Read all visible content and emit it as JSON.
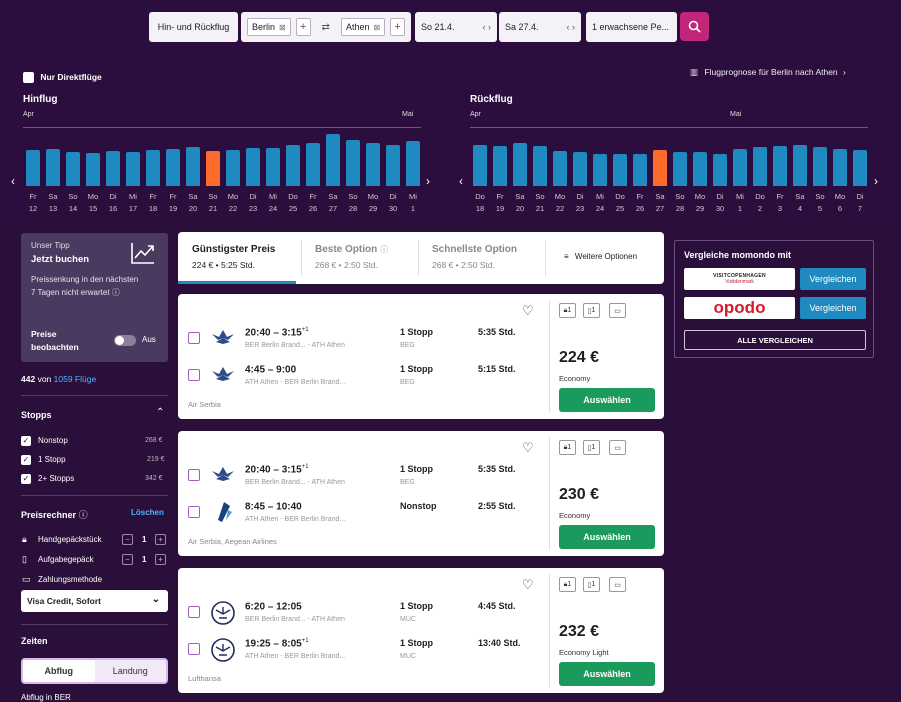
{
  "search": {
    "trip_type": "Hin- und Rückflug",
    "origin": "Berlin",
    "destination": "Athen",
    "swap_icon": "swap-icon",
    "depart_date": "So 21.4.",
    "return_date": "Sa 27.4.",
    "passengers": "1 erwachsene Pe...",
    "search_icon": "search-icon"
  },
  "options": {
    "direct_only": "Nur Direktflüge",
    "forecast_link": "Flugprognose für Berlin nach Athen"
  },
  "outbound": {
    "title": "Hinflug",
    "month_left": "Apr",
    "month_right": "Mai",
    "days": [
      {
        "wd": "Fr",
        "d": "12",
        "v": 0.64,
        "sel": false
      },
      {
        "wd": "Sa",
        "d": "13",
        "v": 0.66,
        "sel": false
      },
      {
        "wd": "So",
        "d": "14",
        "v": 0.61,
        "sel": false
      },
      {
        "wd": "Mo",
        "d": "15",
        "v": 0.59,
        "sel": false
      },
      {
        "wd": "Di",
        "d": "16",
        "v": 0.62,
        "sel": false
      },
      {
        "wd": "Mi",
        "d": "17",
        "v": 0.6,
        "sel": false
      },
      {
        "wd": "Fr",
        "d": "18",
        "v": 0.64,
        "sel": false
      },
      {
        "wd": "Fr",
        "d": "19",
        "v": 0.66,
        "sel": false
      },
      {
        "wd": "Sa",
        "d": "20",
        "v": 0.69,
        "sel": false
      },
      {
        "wd": "So",
        "d": "21",
        "v": 0.62,
        "sel": true
      },
      {
        "wd": "Mo",
        "d": "22",
        "v": 0.64,
        "sel": false
      },
      {
        "wd": "Di",
        "d": "23",
        "v": 0.67,
        "sel": false
      },
      {
        "wd": "Mi",
        "d": "24",
        "v": 0.67,
        "sel": false
      },
      {
        "wd": "Do",
        "d": "25",
        "v": 0.74,
        "sel": false
      },
      {
        "wd": "Fr",
        "d": "26",
        "v": 0.77,
        "sel": false
      },
      {
        "wd": "Sa",
        "d": "27",
        "v": 0.92,
        "sel": false
      },
      {
        "wd": "So",
        "d": "28",
        "v": 0.82,
        "sel": false
      },
      {
        "wd": "Mo",
        "d": "29",
        "v": 0.77,
        "sel": false
      },
      {
        "wd": "Di",
        "d": "30",
        "v": 0.74,
        "sel": false
      },
      {
        "wd": "Mi",
        "d": "1",
        "v": 0.81,
        "sel": false
      }
    ]
  },
  "return": {
    "title": "Rückflug",
    "month_left": "Apr",
    "month_right": "Mai",
    "days": [
      {
        "wd": "Do",
        "d": "18",
        "v": 0.73,
        "sel": false
      },
      {
        "wd": "Fr",
        "d": "19",
        "v": 0.71,
        "sel": false
      },
      {
        "wd": "Sa",
        "d": "20",
        "v": 0.77,
        "sel": false
      },
      {
        "wd": "So",
        "d": "21",
        "v": 0.71,
        "sel": false
      },
      {
        "wd": "Mo",
        "d": "22",
        "v": 0.62,
        "sel": false
      },
      {
        "wd": "Di",
        "d": "23",
        "v": 0.6,
        "sel": false
      },
      {
        "wd": "Mi",
        "d": "24",
        "v": 0.57,
        "sel": false
      },
      {
        "wd": "Do",
        "d": "25",
        "v": 0.57,
        "sel": false
      },
      {
        "wd": "Fr",
        "d": "26",
        "v": 0.57,
        "sel": false
      },
      {
        "wd": "Sa",
        "d": "27",
        "v": 0.64,
        "sel": true
      },
      {
        "wd": "So",
        "d": "28",
        "v": 0.6,
        "sel": false
      },
      {
        "wd": "Mo",
        "d": "29",
        "v": 0.6,
        "sel": false
      },
      {
        "wd": "Di",
        "d": "30",
        "v": 0.57,
        "sel": false
      },
      {
        "wd": "Mi",
        "d": "1",
        "v": 0.66,
        "sel": false
      },
      {
        "wd": "Do",
        "d": "2",
        "v": 0.69,
        "sel": false
      },
      {
        "wd": "Fr",
        "d": "3",
        "v": 0.71,
        "sel": false
      },
      {
        "wd": "Sa",
        "d": "4",
        "v": 0.74,
        "sel": false
      },
      {
        "wd": "So",
        "d": "5",
        "v": 0.69,
        "sel": false
      },
      {
        "wd": "Mo",
        "d": "6",
        "v": 0.66,
        "sel": false
      },
      {
        "wd": "Di",
        "d": "7",
        "v": 0.64,
        "sel": false
      }
    ]
  },
  "tip": {
    "kicker": "Unser Tipp",
    "headline": "Jetzt buchen",
    "description": "Preissenkung in den nächsten 7 Tagen nicht erwartet",
    "watch_label": "Preise beobachten",
    "toggle_state": "Aus"
  },
  "results": {
    "shown": "442",
    "of": "von",
    "total_link": "1059 Flüge"
  },
  "stops_filter": {
    "title": "Stopps",
    "items": [
      {
        "label": "Nonstop",
        "price": "268 €"
      },
      {
        "label": "1 Stopp",
        "price": "219 €"
      },
      {
        "label": "2+ Stopps",
        "price": "342 €"
      }
    ]
  },
  "fee_calc": {
    "title": "Preisrechner",
    "clear": "Löschen",
    "carry_on": "Handgepäckstück",
    "carry_on_count": "1",
    "checked": "Aufgabegepäck",
    "checked_count": "1",
    "payment_label": "Zahlungsmethode",
    "payment_value": "Visa Credit, Sofort"
  },
  "times_filter": {
    "title": "Zeiten",
    "seg_depart": "Abflug",
    "seg_arrive": "Landung",
    "sub": "Abflug in BER"
  },
  "sort_tabs": [
    {
      "title": "Günstigster Preis",
      "sub": "224 € • 5:25 Std."
    },
    {
      "title": "Beste Option",
      "sub": "268 € • 2:50 Std."
    },
    {
      "title": "Schnellste Option",
      "sub": "268 € • 2:50 Std."
    }
  ],
  "more_options": "Weitere Optionen",
  "cards": [
    {
      "legs": [
        {
          "logo": "air-serbia",
          "dep": "20:40",
          "arr": "3:15",
          "plus": "+1",
          "route": "BER Berlin Brand... - ATH Athen",
          "stops": "1 Stopp",
          "via": "BEG",
          "dur": "5:35 Std."
        },
        {
          "logo": "air-serbia",
          "dep": "4:45",
          "arr": "9:00",
          "plus": "",
          "route": "ATH Athen - BER Berlin Brand...",
          "stops": "1 Stopp",
          "via": "BEG",
          "dur": "5:15 Std."
        }
      ],
      "airline": "Air Serbia",
      "price": "224 €",
      "cabin": "Economy",
      "bags": [
        "1",
        "1"
      ]
    },
    {
      "legs": [
        {
          "logo": "air-serbia",
          "dep": "20:40",
          "arr": "3:15",
          "plus": "+1",
          "route": "BER Berlin Brand... - ATH Athen",
          "stops": "1 Stopp",
          "via": "BEG",
          "dur": "5:35 Std."
        },
        {
          "logo": "aegean",
          "dep": "8:45",
          "arr": "10:40",
          "plus": "",
          "route": "ATH Athen - BER Berlin Brand...",
          "stops": "Nonstop",
          "via": "",
          "dur": "2:55 Std."
        }
      ],
      "airline": "Air Serbia, Aegean Airlines",
      "price": "230 €",
      "cabin": "Economy",
      "bags": [
        "1",
        "1"
      ]
    },
    {
      "legs": [
        {
          "logo": "lufthansa",
          "dep": "6:20",
          "arr": "12:05",
          "plus": "",
          "route": "BER Berlin Brand... - ATH Athen",
          "stops": "1 Stopp",
          "via": "MUC",
          "dur": "4:45 Std."
        },
        {
          "logo": "lufthansa",
          "dep": "19:25",
          "arr": "8:05",
          "plus": "+1",
          "route": "ATH Athen - BER Berlin Brand...",
          "stops": "1 Stopp",
          "via": "MUC",
          "dur": "13:40 Std."
        }
      ],
      "airline": "Lufthansa",
      "price": "232 €",
      "cabin": "Economy Light",
      "bags": [
        "1",
        "1"
      ]
    }
  ],
  "select_label": "Auswählen",
  "compare": {
    "title": "Vergleiche momondo mit",
    "partners": [
      {
        "name": "VISITCOPENHAGEN",
        "sub": "Visitdenmark"
      },
      {
        "name": "opodo",
        "sub": ""
      }
    ],
    "button": "Vergleichen",
    "all_button": "ALLE VERGLEICHEN"
  }
}
